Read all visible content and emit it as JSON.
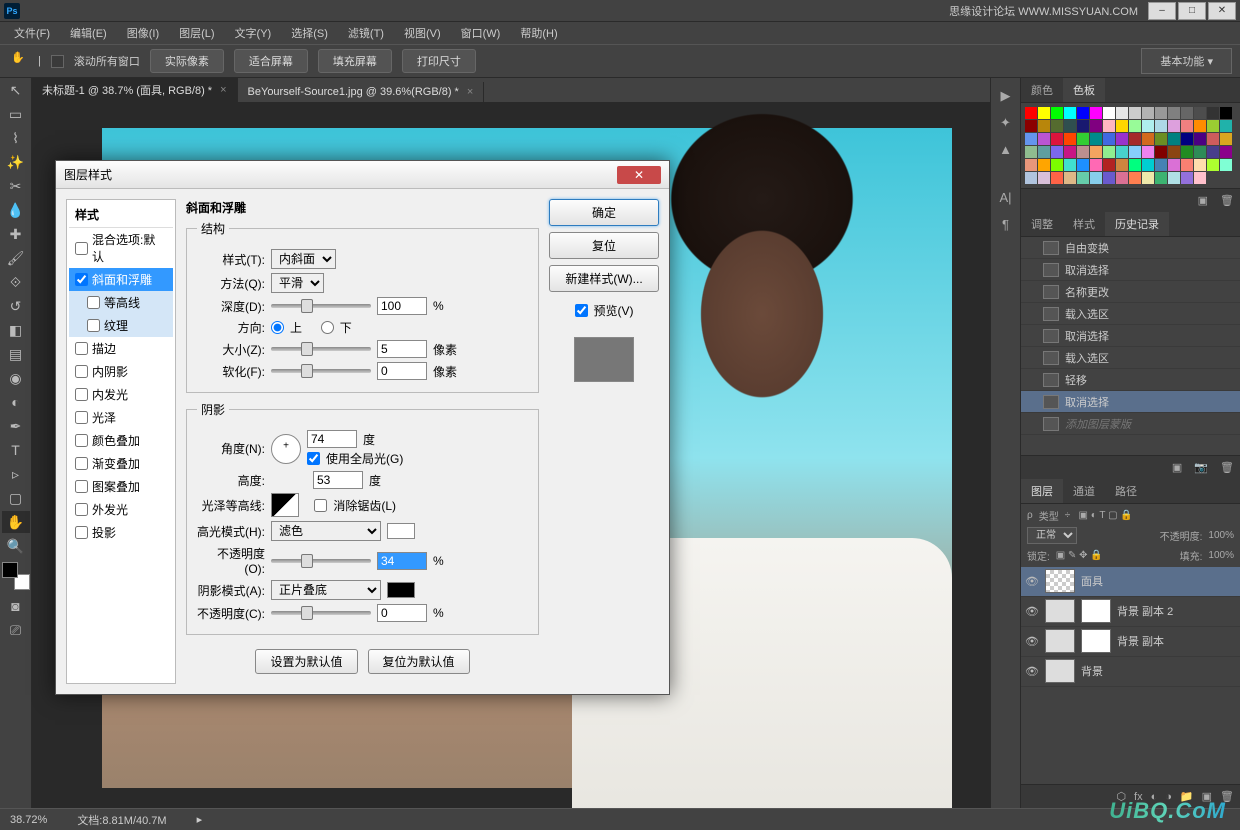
{
  "titlebar": {
    "brand": "思缘设计论坛  WWW.MISSYUAN.COM"
  },
  "menubar": [
    "文件(F)",
    "编辑(E)",
    "图像(I)",
    "图层(L)",
    "文字(Y)",
    "选择(S)",
    "滤镜(T)",
    "视图(V)",
    "窗口(W)",
    "帮助(H)"
  ],
  "options": {
    "scroll_all": "滚动所有窗口",
    "actual": "实际像素",
    "fit": "适合屏幕",
    "fill": "填充屏幕",
    "print": "打印尺寸",
    "workspace": "基本功能"
  },
  "tabs": [
    {
      "label": "未标题-1 @ 38.7% (面具, RGB/8) *",
      "active": true
    },
    {
      "label": "BeYourself-Source1.jpg @ 39.6%(RGB/8) *",
      "active": false
    }
  ],
  "rightPanels": {
    "colorTab": "颜色",
    "swatchesTab": "色板",
    "adjustTab": "调整",
    "stylesTab": "样式",
    "historyTab": "历史记录",
    "history": [
      "自由变换",
      "取消选择",
      "名称更改",
      "载入选区",
      "取消选择",
      "载入选区",
      "轻移",
      "取消选择",
      "添加图层蒙版"
    ],
    "layersTab": "图层",
    "channelsTab": "通道",
    "pathsTab": "路径",
    "blendMode": "正常",
    "opacityLbl": "不透明度:",
    "opacityVal": "100%",
    "lockLbl": "锁定:",
    "fillLbl": "填充:",
    "fillVal": "100%",
    "filterLbl": "类型",
    "layers": [
      {
        "name": "面具",
        "sel": true,
        "mask": false,
        "chk": true
      },
      {
        "name": "背景 副本 2",
        "sel": false,
        "mask": true,
        "chk": false
      },
      {
        "name": "背景 副本",
        "sel": false,
        "mask": true,
        "chk": false
      },
      {
        "name": "背景",
        "sel": false,
        "mask": false,
        "chk": false
      }
    ]
  },
  "status": {
    "zoom": "38.72%",
    "doc": "文档:8.81M/40.7M"
  },
  "watermark": "UiBQ.CoM",
  "dialog": {
    "title": "图层样式",
    "left": {
      "header": "样式",
      "items": [
        {
          "label": "混合选项:默认",
          "chk": false,
          "sel": false,
          "group": false,
          "sub": false
        },
        {
          "label": "斜面和浮雕",
          "chk": true,
          "sel": true,
          "group": true,
          "sub": false
        },
        {
          "label": "等高线",
          "chk": false,
          "sel": false,
          "group": true,
          "sub": true
        },
        {
          "label": "纹理",
          "chk": false,
          "sel": false,
          "group": true,
          "sub": true
        },
        {
          "label": "描边",
          "chk": false,
          "sel": false,
          "group": false,
          "sub": false
        },
        {
          "label": "内阴影",
          "chk": false,
          "sel": false,
          "group": false,
          "sub": false
        },
        {
          "label": "内发光",
          "chk": false,
          "sel": false,
          "group": false,
          "sub": false
        },
        {
          "label": "光泽",
          "chk": false,
          "sel": false,
          "group": false,
          "sub": false
        },
        {
          "label": "颜色叠加",
          "chk": false,
          "sel": false,
          "group": false,
          "sub": false
        },
        {
          "label": "渐变叠加",
          "chk": false,
          "sel": false,
          "group": false,
          "sub": false
        },
        {
          "label": "图案叠加",
          "chk": false,
          "sel": false,
          "group": false,
          "sub": false
        },
        {
          "label": "外发光",
          "chk": false,
          "sel": false,
          "group": false,
          "sub": false
        },
        {
          "label": "投影",
          "chk": false,
          "sel": false,
          "group": false,
          "sub": false
        }
      ]
    },
    "mid": {
      "heading1": "斜面和浮雕",
      "fs1": "结构",
      "styleLbl": "样式(T):",
      "styleVal": "内斜面",
      "methodLbl": "方法(Q):",
      "methodVal": "平滑",
      "depthLbl": "深度(D):",
      "depthVal": "100",
      "pct": "%",
      "dirLbl": "方向:",
      "up": "上",
      "down": "下",
      "sizeLbl": "大小(Z):",
      "sizeVal": "5",
      "px": "像素",
      "softenLbl": "软化(F):",
      "softenVal": "0",
      "fs2": "阴影",
      "angleLbl": "角度(N):",
      "angleVal": "74",
      "deg": "度",
      "globalLbl": "使用全局光(G)",
      "altLbl": "高度:",
      "altVal": "53",
      "glossLbl": "光泽等高线:",
      "antiLbl": "消除锯齿(L)",
      "hlModeLbl": "高光模式(H):",
      "hlModeVal": "滤色",
      "hlOpLbl": "不透明度(O):",
      "hlOpVal": "34",
      "shModeLbl": "阴影模式(A):",
      "shModeVal": "正片叠底",
      "shOpLbl": "不透明度(C):",
      "shOpVal": "0",
      "defBtn": "设置为默认值",
      "resBtn": "复位为默认值"
    },
    "right": {
      "ok": "确定",
      "cancel": "复位",
      "newStyle": "新建样式(W)...",
      "preview": "预览(V)"
    }
  },
  "swatch_colors": [
    "#ff0000",
    "#ffff00",
    "#00ff00",
    "#00ffff",
    "#0000ff",
    "#ff00ff",
    "#ffffff",
    "#e6e6e6",
    "#cccccc",
    "#b3b3b3",
    "#999999",
    "#808080",
    "#666666",
    "#4d4d4d",
    "#333333",
    "#000000",
    "#8b0000",
    "#b8860b",
    "#556b2f",
    "#2f4f4f",
    "#191970",
    "#800080",
    "#ffb6c1",
    "#ffd700",
    "#98fb98",
    "#afeeee",
    "#add8e6",
    "#dda0dd",
    "#f08080",
    "#ff8c00",
    "#9acd32",
    "#20b2aa",
    "#6495ed",
    "#ba55d3",
    "#dc143c",
    "#ff4500",
    "#32cd32",
    "#008b8b",
    "#4169e1",
    "#9932cc",
    "#a52a2a",
    "#d2691e",
    "#6b8e23",
    "#008080",
    "#000080",
    "#4b0082",
    "#cd5c5c",
    "#daa520",
    "#8fbc8f",
    "#5f9ea0",
    "#7b68ee",
    "#c71585",
    "#bc8f8f",
    "#f4a460",
    "#90ee90",
    "#48d1cc",
    "#87cefa",
    "#ee82ee",
    "#800000",
    "#8b4513",
    "#228b22",
    "#2e8b57",
    "#483d8b",
    "#8b008b",
    "#e9967a",
    "#ffa500",
    "#7cfc00",
    "#40e0d0",
    "#1e90ff",
    "#ff69b4",
    "#b22222",
    "#cd853f",
    "#00ff7f",
    "#00ced1",
    "#4682b4",
    "#da70d6",
    "#fa8072",
    "#ffdead",
    "#adff2f",
    "#7fffd4",
    "#b0c4de",
    "#d8bfd8",
    "#ff6347",
    "#deb887",
    "#66cdaa",
    "#87ceeb",
    "#6a5acd",
    "#db7093",
    "#ff7f50",
    "#eee8aa",
    "#3cb371",
    "#b0e0e6",
    "#9370db",
    "#ffc0cb"
  ]
}
